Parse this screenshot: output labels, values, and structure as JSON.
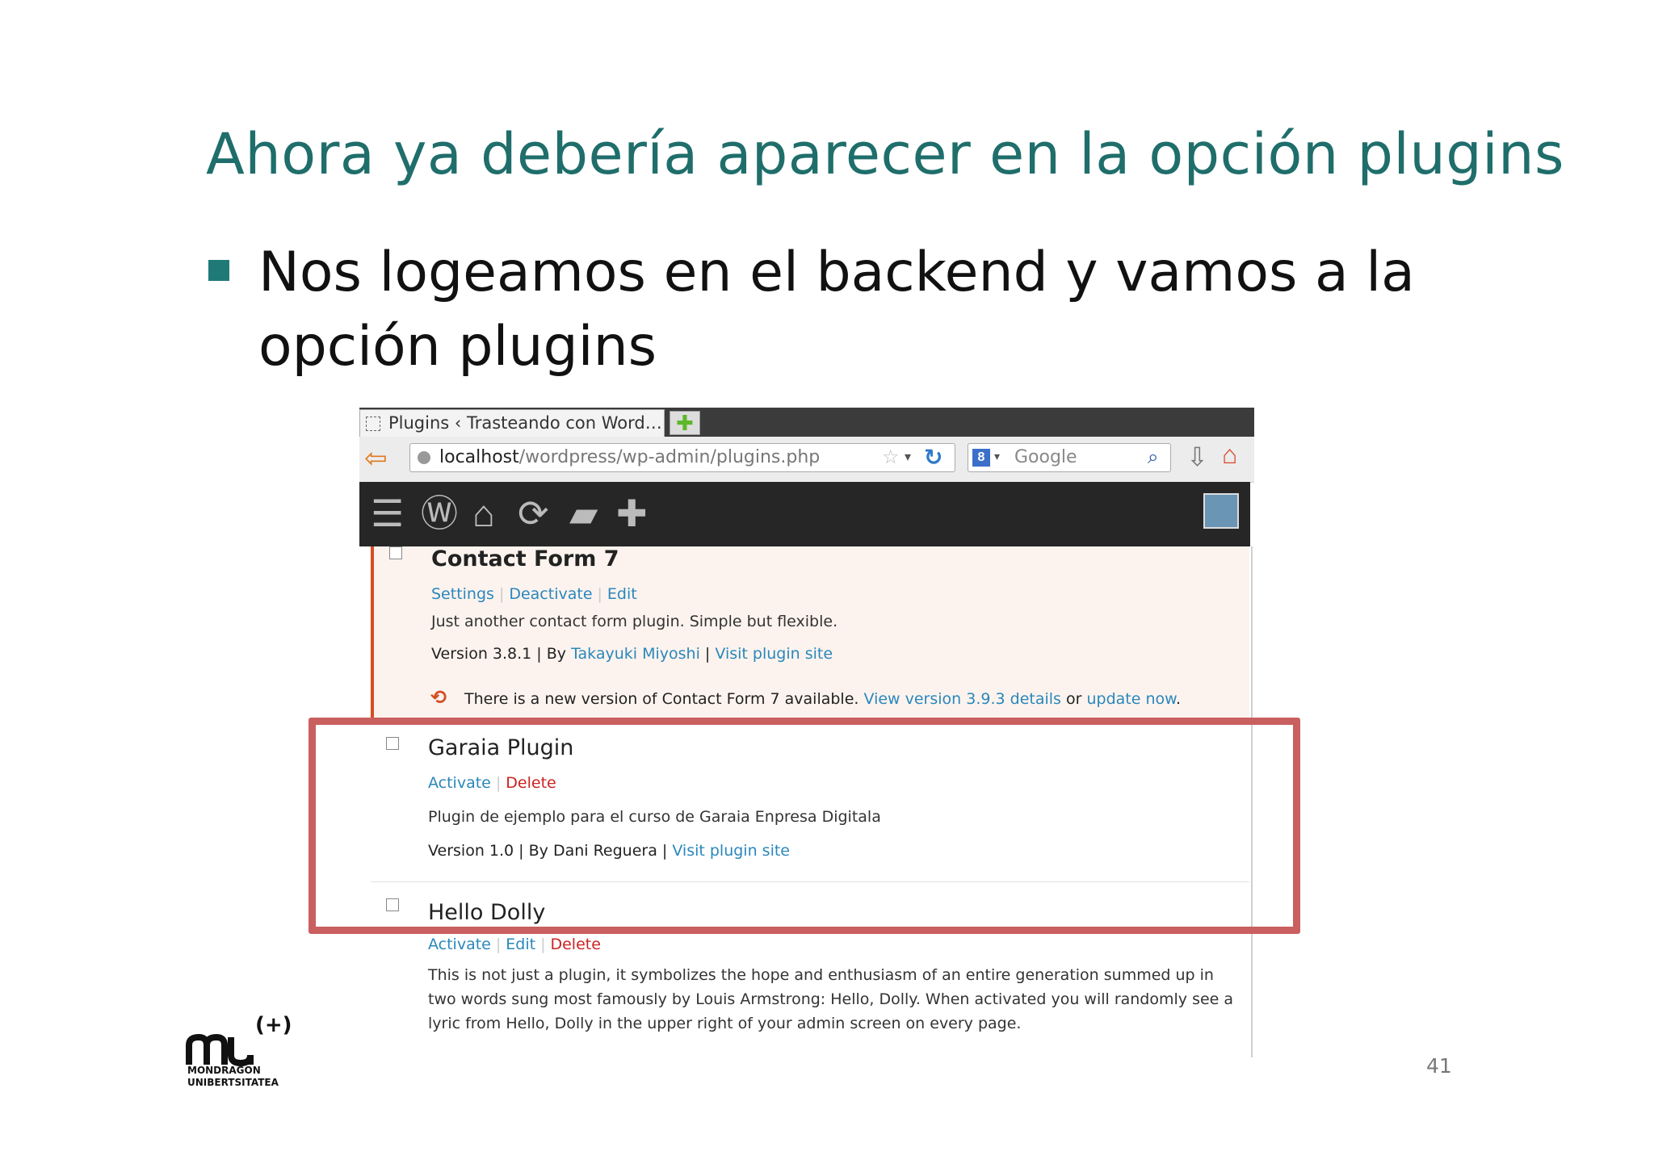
{
  "slide": {
    "title": "Ahora ya debería aparecer en la opción plugins",
    "bullet": "Nos logeamos en el backend y vamos a la opción plugins",
    "page_number": "41"
  },
  "logo": {
    "mark_text": "mu",
    "superscript": "(+)",
    "line1": "MONDRAGON",
    "line2": "UNIBERTSITATEA"
  },
  "browser": {
    "tab_title": "Plugins ‹ Trasteando con Word…",
    "url_host": "localhost",
    "url_path": "/wordpress/wp-admin/plugins.php",
    "search_placeholder": "Google",
    "icons": [
      "back-arrow-icon",
      "globe-icon",
      "star-icon",
      "reload-icon",
      "google-icon",
      "search-icon",
      "download-icon",
      "home-icon"
    ]
  },
  "wp_admin_bar": {
    "icons": [
      "menu-icon",
      "wordpress-icon",
      "home-icon",
      "updates-icon",
      "comments-icon",
      "new-content-icon",
      "avatar"
    ]
  },
  "plugins": [
    {
      "name": "Contact Form 7",
      "actions": [
        "Settings",
        "Deactivate",
        "Edit"
      ],
      "description": "Just another contact form plugin. Simple but flexible.",
      "version": "Version 3.8.1",
      "by_label": "By",
      "author": "Takayuki Miyoshi",
      "site_link": "Visit plugin site",
      "update_text": "There is a new version of Contact Form 7 available.",
      "update_link_details": "View version 3.9.3 details",
      "update_or": "or",
      "update_link_now": "update now",
      "status": "active"
    },
    {
      "name": "Garaia Plugin",
      "actions": [
        "Activate",
        "Delete"
      ],
      "description": "Plugin de ejemplo para el curso de Garaia Enpresa Digitala",
      "version": "Version 1.0",
      "by_label": "By",
      "author": "Dani Reguera",
      "site_link": "Visit plugin site",
      "status": "inactive"
    },
    {
      "name": "Hello Dolly",
      "actions": [
        "Activate",
        "Edit",
        "Delete"
      ],
      "description": "This is not just a plugin, it symbolizes the hope and enthusiasm of an entire generation summed up in two words sung most famously by Louis Armstrong: Hello, Dolly. When activated you will randomly see a lyric from Hello, Dolly in the upper right of your admin screen on every page.",
      "status": "inactive"
    }
  ],
  "colors": {
    "title": "#1f6e6b",
    "bullet": "#1f7a77",
    "highlight": "#c95f5f",
    "link": "#2a87bb",
    "delete": "#cc2222",
    "active_border": "#d54e21"
  }
}
